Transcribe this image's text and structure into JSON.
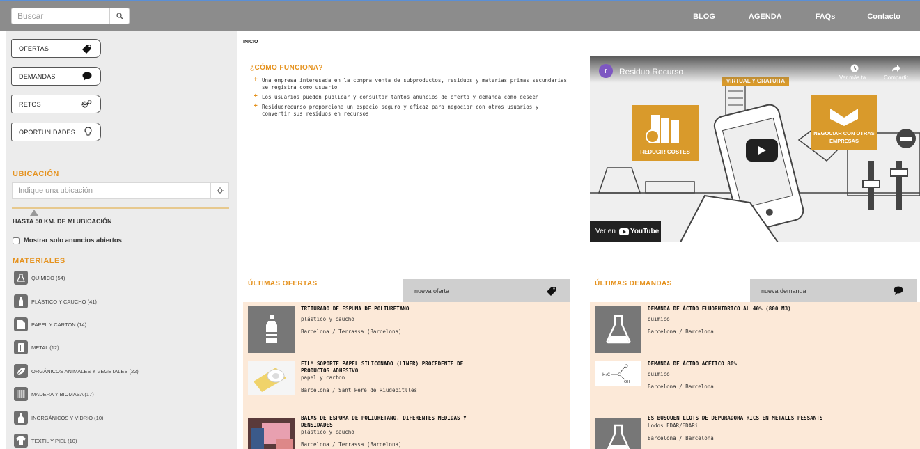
{
  "search": {
    "placeholder": "Buscar"
  },
  "nav": {
    "blog": "BLOG",
    "agenda": "AGENDA",
    "faqs": "FAQs",
    "contact": "Contacto"
  },
  "sidebar": {
    "categories": [
      {
        "label": "OFERTAS",
        "icon": "tag-icon"
      },
      {
        "label": "DEMANDAS",
        "icon": "speech-bubble-icon"
      },
      {
        "label": "RETOS",
        "icon": "gears-icon"
      },
      {
        "label": "OPORTUNIDADES",
        "icon": "lightbulb-icon"
      }
    ],
    "location_title": "UBICACIÓN",
    "location_placeholder": "Indique una ubicación",
    "range_label": "HASTA 50 KM. DE MI UBICACIÓN",
    "range_value_km": 50,
    "open_only_label": "Mostrar solo anuncios abiertos",
    "materials_title": "MATERIALES",
    "materials": [
      {
        "label": "QUIMICO (54)",
        "icon": "flask-icon"
      },
      {
        "label": "PLÁSTICO Y CAUCHO (41)",
        "icon": "bottle-icon"
      },
      {
        "label": "PAPEL Y CARTON (14)",
        "icon": "paper-icon"
      },
      {
        "label": "METAL (12)",
        "icon": "can-icon"
      },
      {
        "label": "ORGÁNICOS ANIMALES Y VEGETALES (22)",
        "icon": "leaf-icon"
      },
      {
        "label": "MADERA Y BIOMASA (17)",
        "icon": "wood-icon"
      },
      {
        "label": "INORGÁNICOS Y VIDRIO (10)",
        "icon": "glass-icon"
      },
      {
        "label": "TEXTIL Y PIEL (10)",
        "icon": "shirt-icon"
      }
    ]
  },
  "main": {
    "breadcrumb": "INICIO",
    "how_title": "¿CÓMO FUNCIONA?",
    "how_items": [
      "Una empresa interesada en la compra venta de subproductos, residuos y materias primas secundarias se registra como usuario",
      "Los usuarios pueden publicar y consultar tantos anuncios de oferta y demanda como deseen",
      "Residuorecurso proporciona un espacio seguro y eficaz para negociar con otros usuarios y convertir sus residuos en recursos"
    ],
    "video": {
      "channel_initial": "r",
      "title": "Residuo Recurso",
      "watch_later": "Ver más ta...",
      "share": "Compartir",
      "label_virtual": "VIRTUAL Y GRATUITA",
      "label_costs": "REDUCIR COSTES",
      "label_negotiate": "NEGOCIAR CON OTRAS EMPRESAS",
      "watch_on": "Ver en",
      "youtube": "YouTube"
    },
    "offers": {
      "title": "ÚLTIMAS OFERTAS",
      "new_label": "nueva oferta",
      "items": [
        {
          "title": "TRITURADO DE ESPUMA DE POLIURETANO",
          "category": "plástico y caucho",
          "location": "Barcelona / Terrassa (Barcelona)"
        },
        {
          "title": "FILM SOPORTE PAPEL SILICONADO (LINER) PROCEDENTE DE PRODUCTOS ADHESIVO",
          "category": "papel y carton",
          "location": "Barcelona / Sant Pere de Riudebitlles"
        },
        {
          "title": "BALAS DE ESPUMA DE POLIURETANO. DIFERENTES MEDIDAS Y DENSIDADES",
          "category": "plástico y caucho",
          "location": "Barcelona / Terrassa (Barcelona)"
        }
      ]
    },
    "demands": {
      "title": "ÚLTIMAS DEMANDAS",
      "new_label": "nueva demanda",
      "items": [
        {
          "title": "DEMANDA DE ÁCIDO FLUORHIDRICO AL 40% (800 M3)",
          "category": "quimico",
          "location": "Barcelona / Barcelona"
        },
        {
          "title": "DEMANDA DE ÁCIDO ACÉTICO 80%",
          "category": "quimico",
          "location": "Barcelona / Barcelona"
        },
        {
          "title": "ES BUSQUEN LLOTS DE DEPURADORA RICS EN METALLS PESSANTS",
          "category": "Lodos EDAR/EDARi",
          "location": "Barcelona / Barcelona"
        }
      ]
    }
  },
  "colors": {
    "accent": "#e5921e",
    "topbar": "#8c8c8c",
    "listing_bg": "#fce9d8"
  }
}
